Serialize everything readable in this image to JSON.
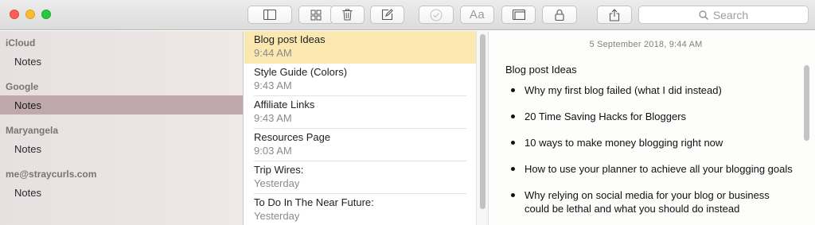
{
  "toolbar": {
    "search_placeholder": "Search",
    "aa_label": "Aa"
  },
  "sidebar": {
    "accounts": [
      {
        "name": "iCloud",
        "folder": "Notes"
      },
      {
        "name": "Google",
        "folder": "Notes"
      },
      {
        "name": "Maryangela",
        "folder": "Notes"
      },
      {
        "name": "me@straycurls.com",
        "folder": "Notes"
      }
    ]
  },
  "notes": [
    {
      "title": "Blog post Ideas",
      "date": "9:44 AM"
    },
    {
      "title": "Style Guide (Colors)",
      "date": "9:43 AM"
    },
    {
      "title": "Affiliate Links",
      "date": "9:43 AM"
    },
    {
      "title": "Resources Page",
      "date": "9:03 AM"
    },
    {
      "title": "Trip Wires:",
      "date": "Yesterday"
    },
    {
      "title": "To Do In The Near Future:",
      "date": "Yesterday"
    }
  ],
  "editor": {
    "date": "5 September 2018, 9:44 AM",
    "title": "Blog post Ideas",
    "bullets": [
      "Why my first blog failed (what I did instead)",
      "20 Time Saving Hacks for Bloggers",
      "10 ways to make money blogging right now",
      "How to use your planner to achieve all your blogging goals",
      "Why relying on social media for your blog or business could be lethal and what you should do instead"
    ]
  },
  "colors": {
    "selected_note": "#fbe8b1",
    "selected_folder": "#bfa9ac"
  }
}
